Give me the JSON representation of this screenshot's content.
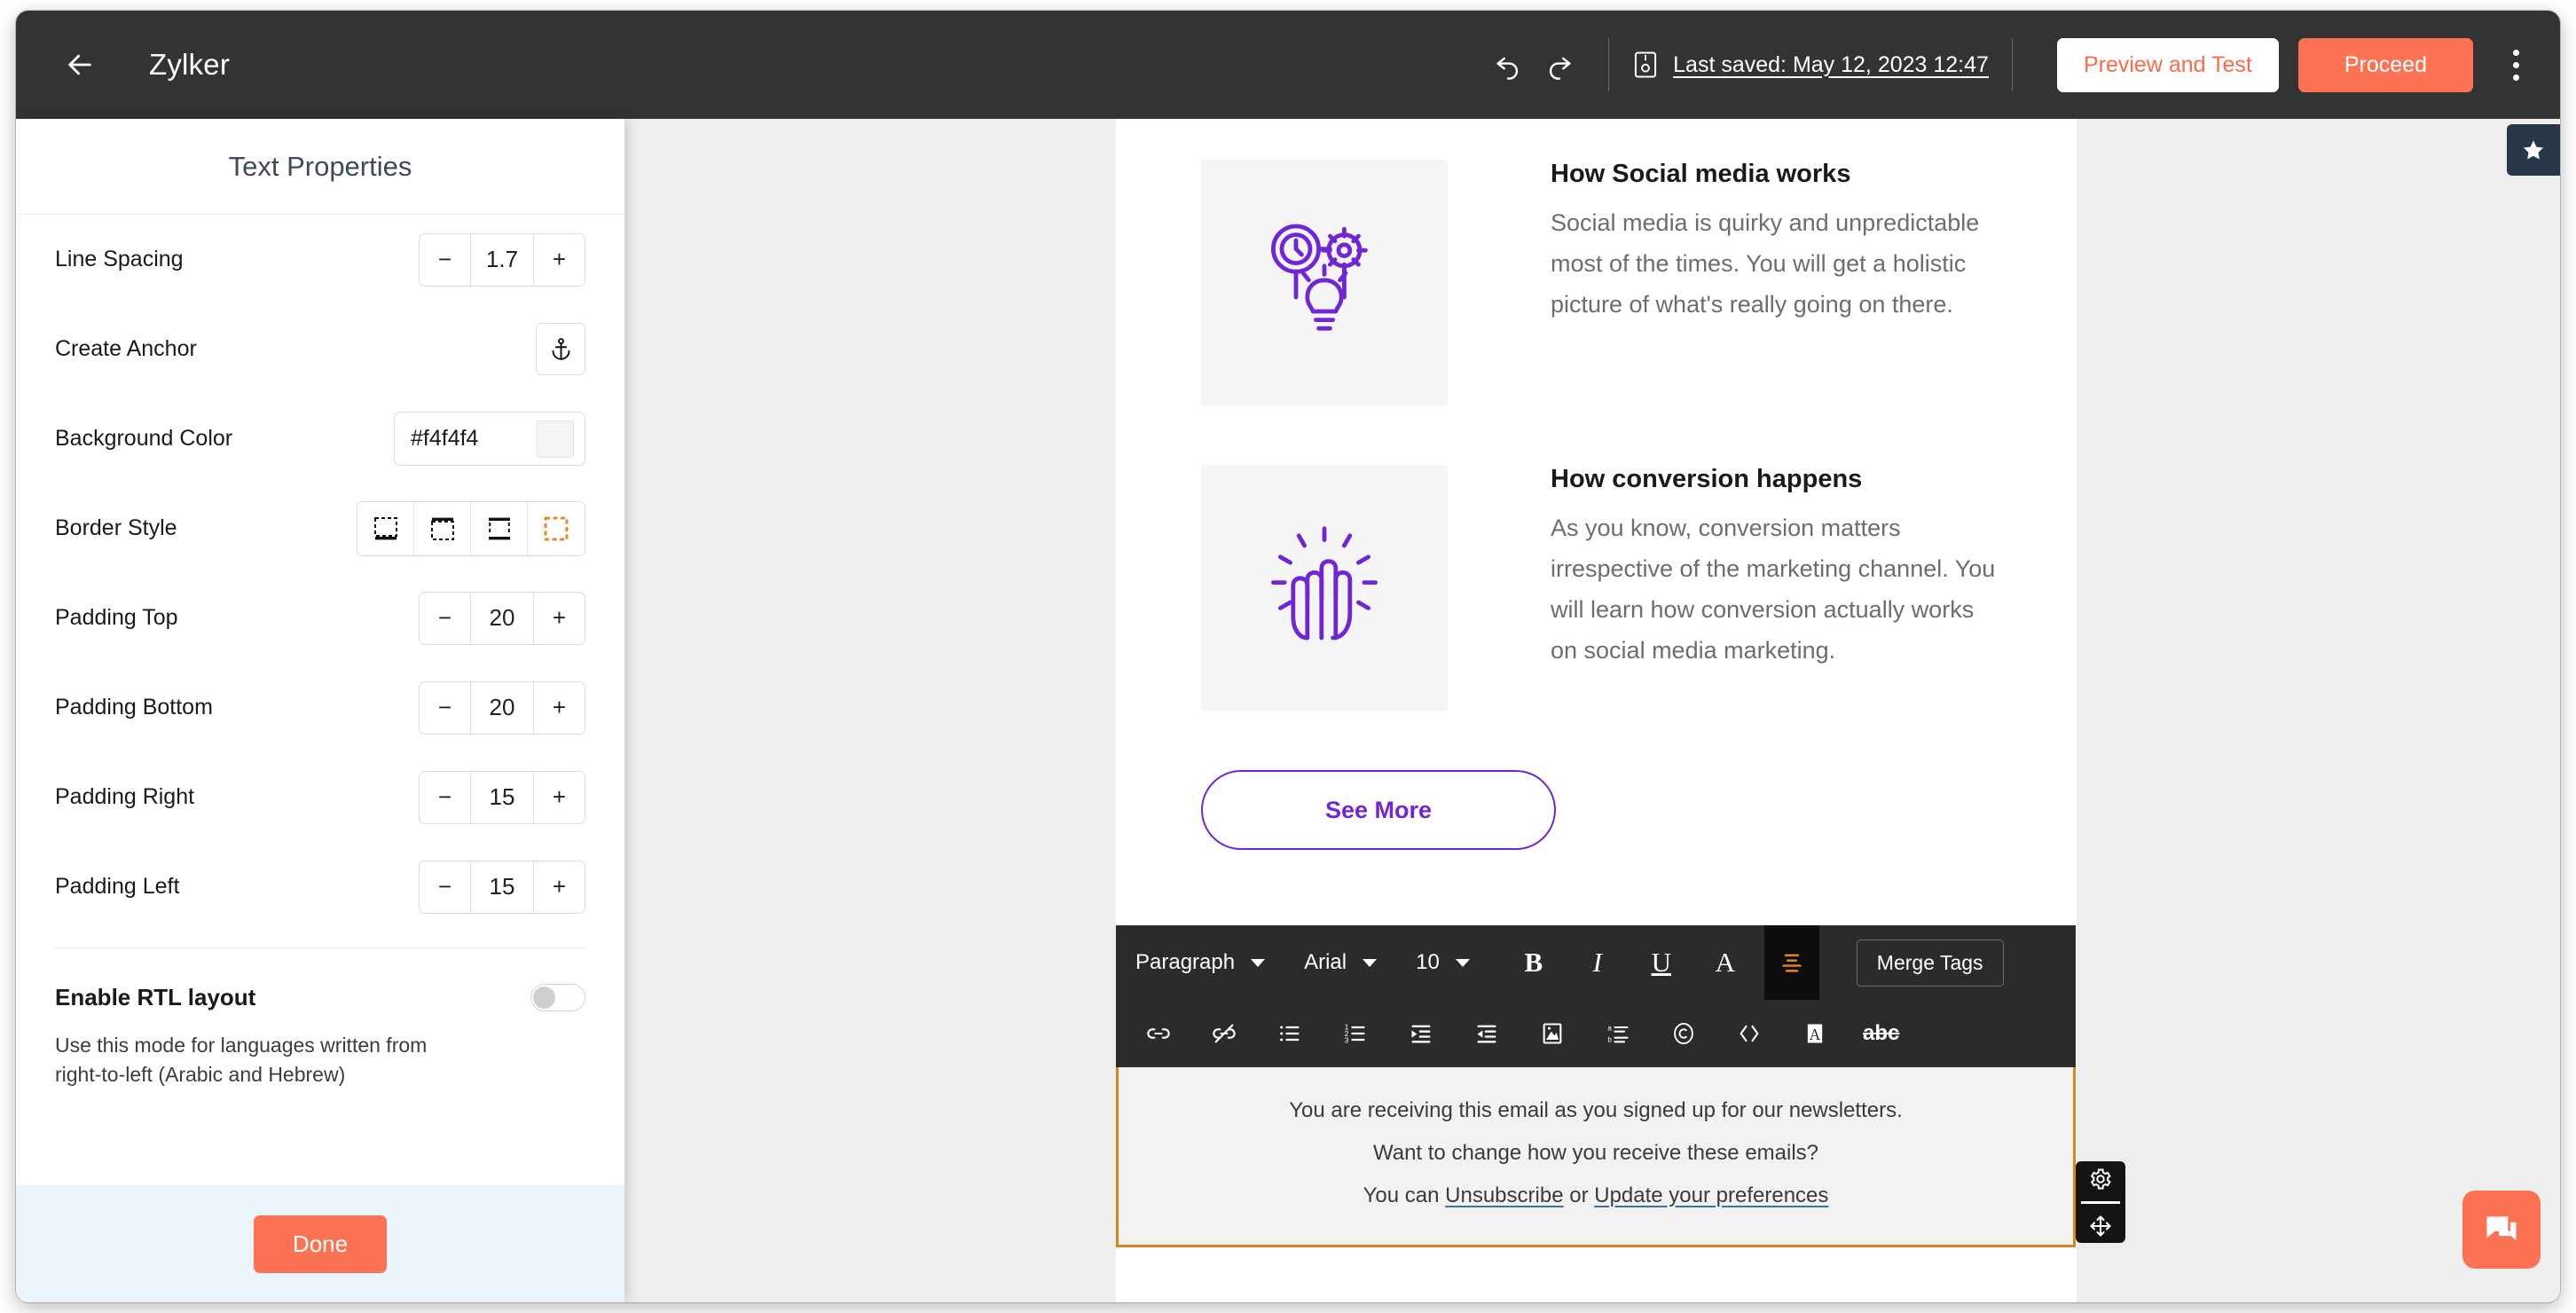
{
  "header": {
    "back_icon": "arrow-left-icon",
    "title": "Zylker",
    "undo_icon": "undo-icon",
    "redo_icon": "redo-icon",
    "save_icon": "save-disk-icon",
    "last_saved": "Last saved: May 12, 2023 12:47",
    "preview_label": "Preview and Test",
    "proceed_label": "Proceed",
    "more_icon": "kebab-menu-icon",
    "accent_color": "#fc7354",
    "bar_color": "#333333"
  },
  "panel": {
    "title": "Text Properties",
    "rows": [
      {
        "label": "Line Spacing",
        "type": "stepper",
        "value": "1.7"
      },
      {
        "label": "Create Anchor",
        "type": "button",
        "icon": "anchor-icon"
      },
      {
        "label": "Background Color",
        "type": "color",
        "value": "#f4f4f4"
      },
      {
        "label": "Border Style",
        "type": "border-options"
      },
      {
        "label": "Padding Top",
        "type": "stepper",
        "value": "20"
      },
      {
        "label": "Padding Bottom",
        "type": "stepper",
        "value": "20"
      },
      {
        "label": "Padding Right",
        "type": "stepper",
        "value": "15"
      },
      {
        "label": "Padding Left",
        "type": "stepper",
        "value": "15"
      }
    ],
    "border_options": [
      {
        "name": "border-bottom-only",
        "selected": false
      },
      {
        "name": "border-top-only",
        "selected": false
      },
      {
        "name": "border-top-and-bottom",
        "selected": false
      },
      {
        "name": "border-all-sides",
        "selected": true
      }
    ],
    "selected_border_color": "#e2892b",
    "minus_label": "−",
    "plus_label": "+",
    "rtl": {
      "label": "Enable RTL layout",
      "description": "Use this mode for languages written from right-to-left (Arabic and Hebrew)",
      "enabled": false
    },
    "done_label": "Done"
  },
  "email": {
    "blocks": [
      {
        "image_icon": "clock-gear-bulb-icon",
        "title": "How Social media works",
        "body": "Social media is quirky and unpredictable most of the times. You will get a holistic picture of what's really going on there."
      },
      {
        "image_icon": "raised-hands-icon",
        "title": "How conversion happens",
        "body": "As you know, conversion matters irrespective of the marketing channel. You will learn how conversion actually works on social media marketing."
      }
    ],
    "cta_label": "See More",
    "cta_color": "#7126d6",
    "footer": {
      "line1": "You are receiving this email as you signed up for our newsletters.",
      "line2": "Want to change how you receive these emails?",
      "line3_prefix": "You can ",
      "link1": "Unsubscribe",
      "line3_mid": " or ",
      "link2": "Update your preferences",
      "selection_color": "#d3891e"
    }
  },
  "toolbar": {
    "paragraph_select": "Paragraph",
    "font_select": "Arial",
    "size_select": "10",
    "bold_label": "B",
    "italic_label": "I",
    "underline_label": "U",
    "font_color_label": "A",
    "align_icon": "align-center-icon",
    "merge_tags_label": "Merge Tags",
    "active_color": "#d98324",
    "row2_icons": [
      "link-icon",
      "unlink-icon",
      "bullet-list-icon",
      "numbered-list-icon",
      "indent-increase-icon",
      "indent-decrease-icon",
      "insert-image-icon",
      "special-characters-icon",
      "copyright-icon",
      "source-code-icon",
      "text-background-icon"
    ],
    "strikethrough_label": "abc"
  },
  "block_controls": {
    "settings_icon": "gear-icon",
    "move_icon": "move-arrows-icon"
  },
  "floating": {
    "star_icon": "star-icon",
    "chat_icon": "chat-bubble-icon"
  }
}
